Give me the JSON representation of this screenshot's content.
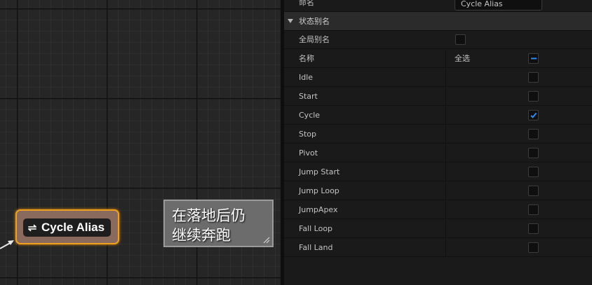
{
  "graph": {
    "node_title": "Cycle Alias",
    "node_icon": "alias-swap-icon",
    "comment_text": "在落地后仍\n继续奔跑",
    "node_border_color": "#f0a020"
  },
  "details": {
    "name_label": "命名",
    "name_value": "Cycle Alias",
    "section_title": "状态别名",
    "global_alias_label": "全局别名",
    "global_alias_checked": false,
    "name_header_label": "名称",
    "select_all_label": "全选",
    "states": [
      {
        "label": "Idle",
        "checked": false
      },
      {
        "label": "Start",
        "checked": false
      },
      {
        "label": "Cycle",
        "checked": true
      },
      {
        "label": "Stop",
        "checked": false
      },
      {
        "label": "Pivot",
        "checked": false
      },
      {
        "label": "Jump Start",
        "checked": false
      },
      {
        "label": "Jump Loop",
        "checked": false
      },
      {
        "label": "JumpApex",
        "checked": false
      },
      {
        "label": "Fall Loop",
        "checked": false
      },
      {
        "label": "Fall Land",
        "checked": false
      }
    ],
    "accent_color": "#2a8cf0"
  }
}
